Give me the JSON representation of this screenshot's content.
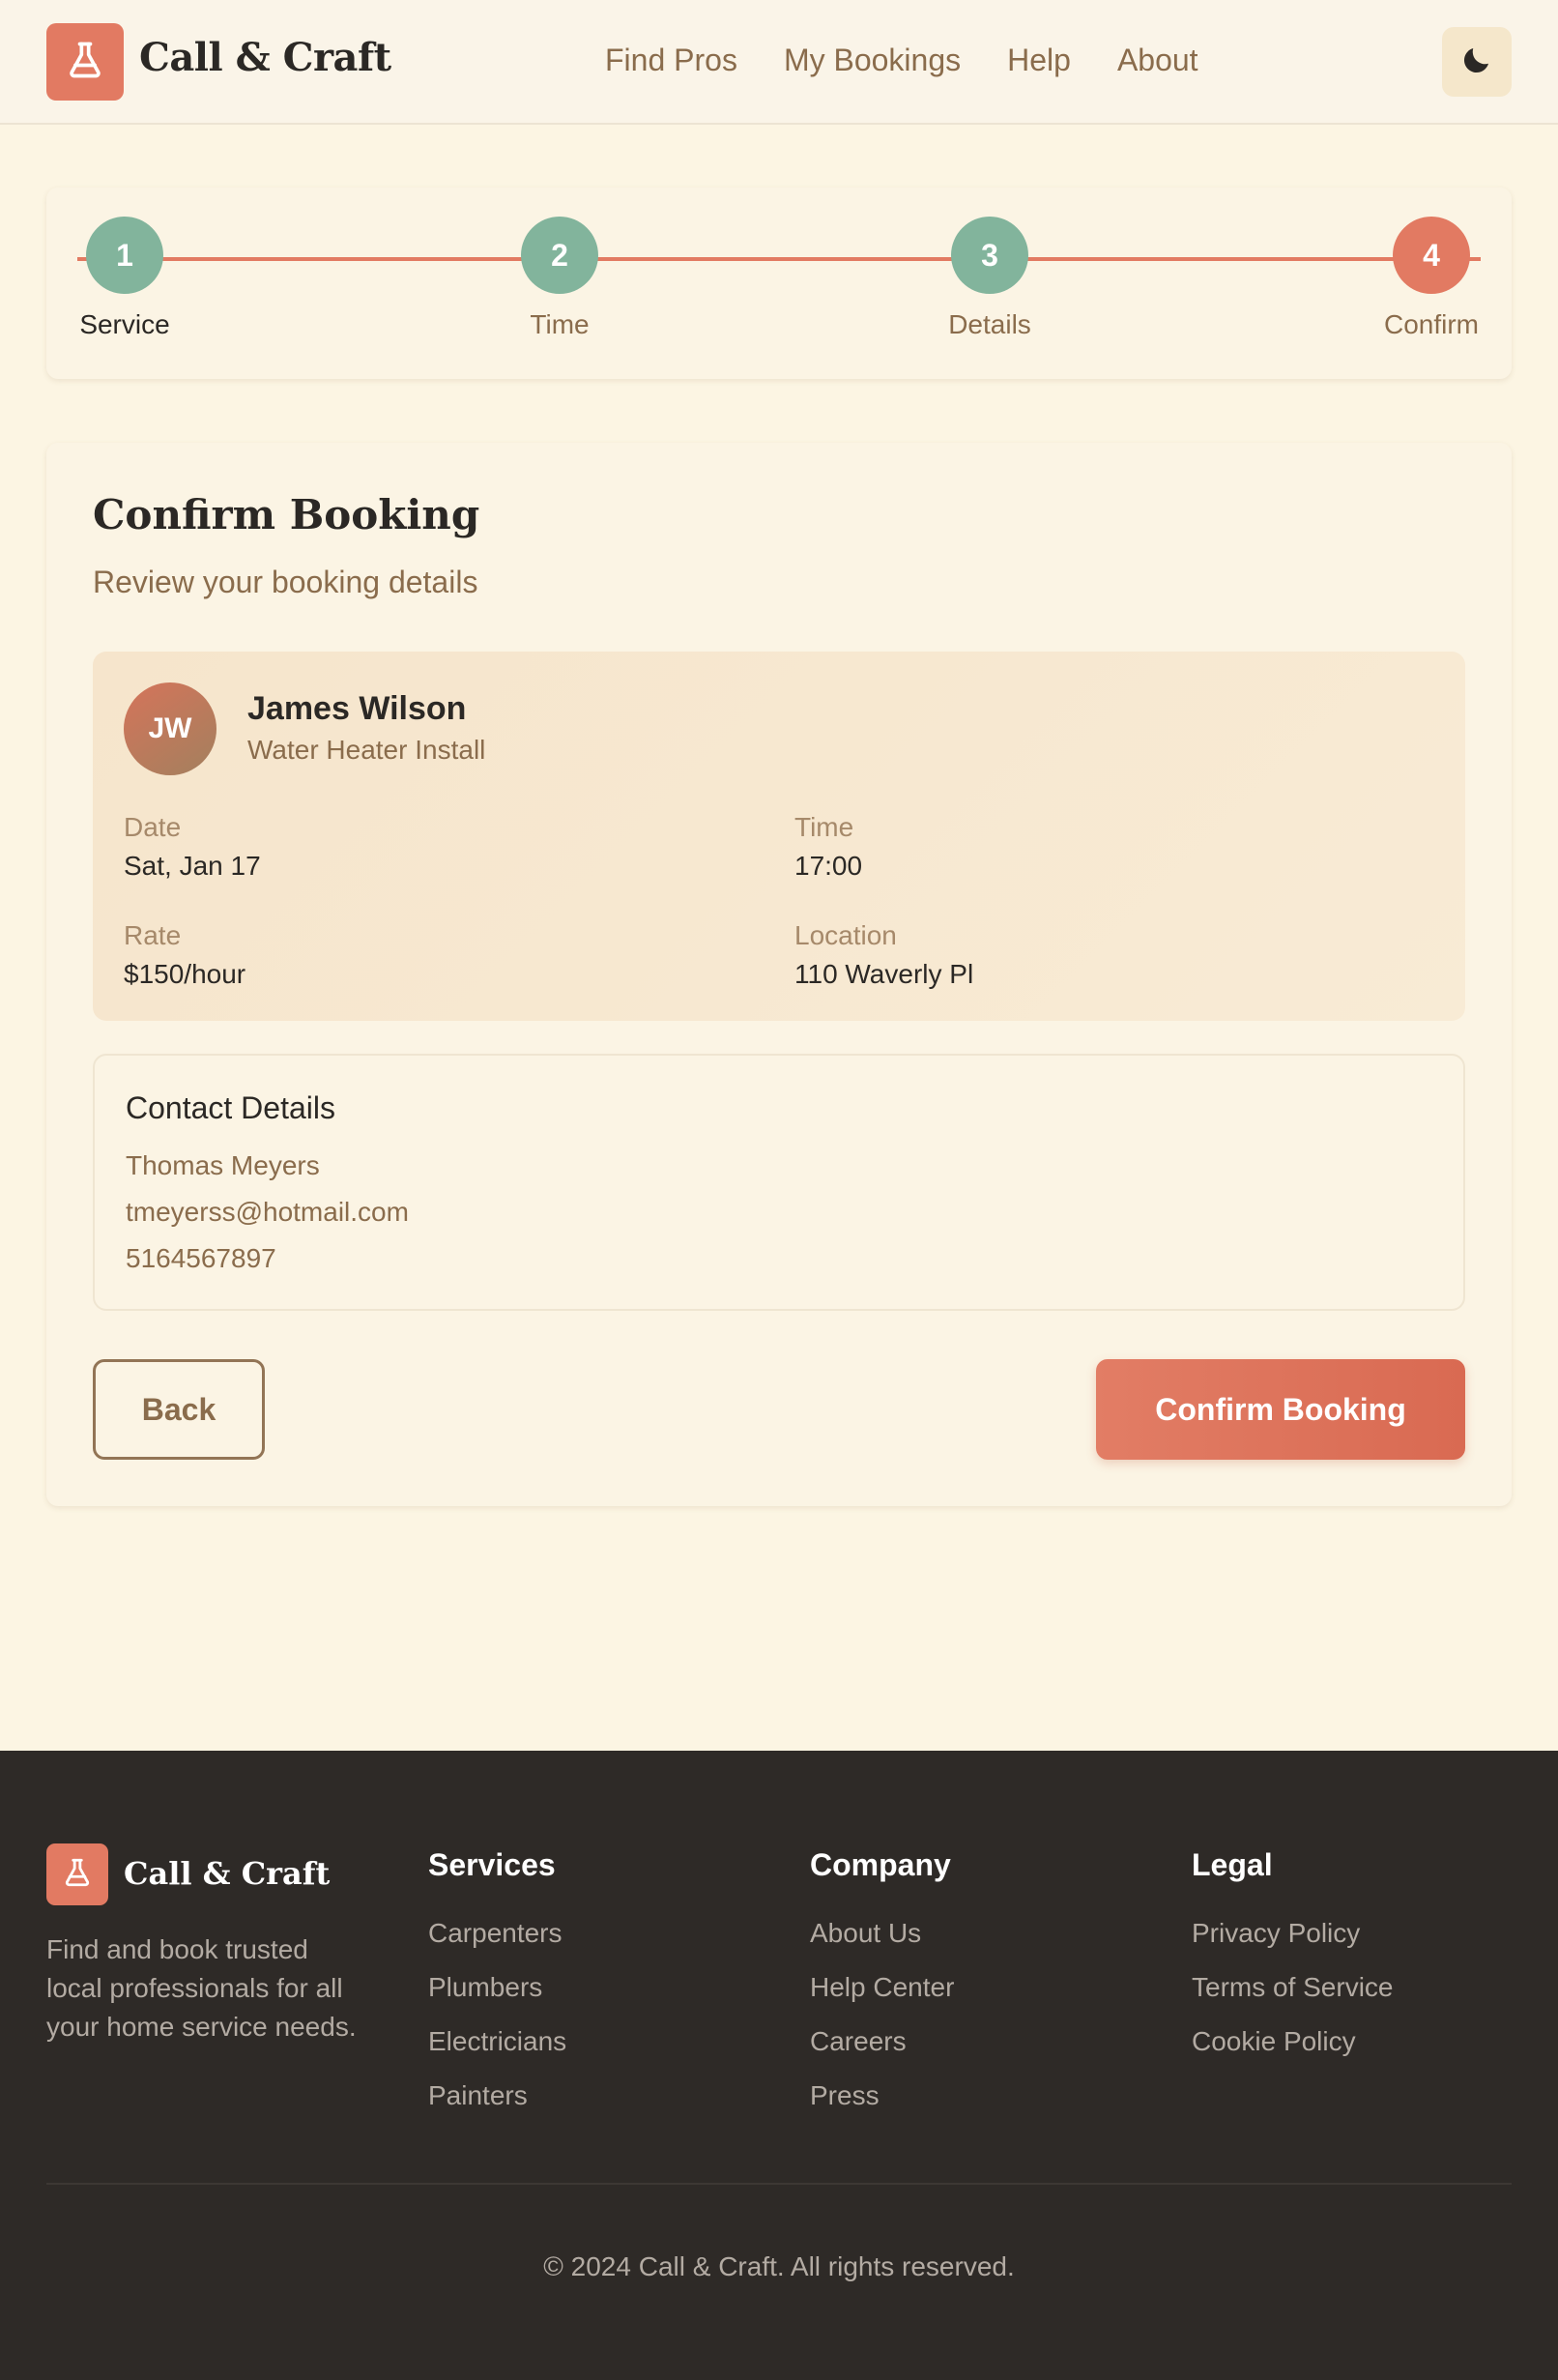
{
  "header": {
    "brand": "Call & Craft",
    "nav": [
      "Find Pros",
      "My Bookings",
      "Help",
      "About"
    ],
    "theme_icon": "moon-icon",
    "logo_icon": "flask-icon"
  },
  "stepper": {
    "steps": [
      {
        "number": "1",
        "label": "Service",
        "status": "done"
      },
      {
        "number": "2",
        "label": "Time",
        "status": "done"
      },
      {
        "number": "3",
        "label": "Details",
        "status": "done"
      },
      {
        "number": "4",
        "label": "Confirm",
        "status": "current"
      }
    ]
  },
  "booking": {
    "title": "Confirm Booking",
    "subtitle": "Review your booking details",
    "pro": {
      "initials": "JW",
      "name": "James Wilson",
      "service": "Water Heater Install"
    },
    "fields": {
      "date_label": "Date",
      "date_value": "Sat, Jan 17",
      "time_label": "Time",
      "time_value": "17:00",
      "rate_label": "Rate",
      "rate_value": "$150/hour",
      "location_label": "Location",
      "location_value": "110 Waverly Pl"
    },
    "contact": {
      "title": "Contact Details",
      "name": "Thomas Meyers",
      "email": "tmeyerss@hotmail.com",
      "phone": "5164567897"
    },
    "back_label": "Back",
    "confirm_label": "Confirm Booking"
  },
  "footer": {
    "brand": "Call & Craft",
    "description": "Find and book trusted local professionals for all your home service needs.",
    "columns": [
      {
        "title": "Services",
        "links": [
          "Carpenters",
          "Plumbers",
          "Electricians",
          "Painters"
        ]
      },
      {
        "title": "Company",
        "links": [
          "About Us",
          "Help Center",
          "Careers",
          "Press"
        ]
      },
      {
        "title": "Legal",
        "links": [
          "Privacy Policy",
          "Terms of Service",
          "Cookie Policy"
        ]
      }
    ],
    "copyright": "© 2024 Call & Craft. All rights reserved."
  },
  "colors": {
    "accent": "#e27a62",
    "done": "#82b49c",
    "background": "#fcf5e3",
    "footer": "#2e2a27",
    "muted_text": "#8a6c4c"
  }
}
